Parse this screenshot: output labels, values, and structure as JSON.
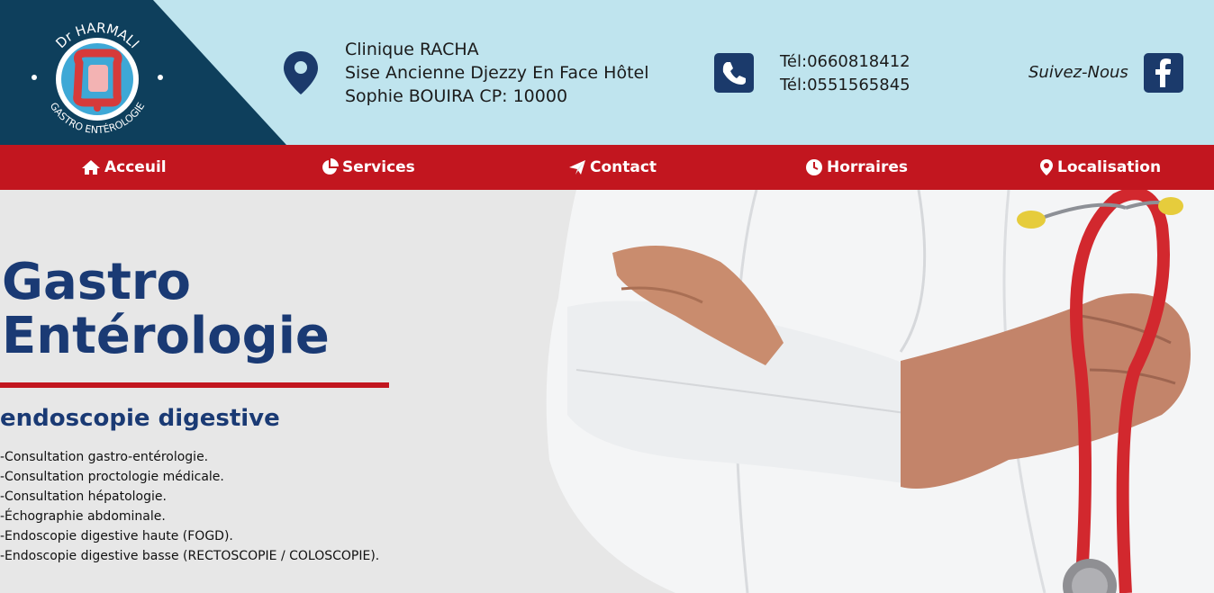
{
  "logo": {
    "top_text": "Dr HARMALI",
    "bottom_text": "GASTRO ENTÉROLOGIE"
  },
  "address": {
    "line1": "Clinique RACHA",
    "line2": "Sise Ancienne Djezzy En Face Hôtel",
    "line3": "Sophie BOUIRA CP: 10000"
  },
  "phones": {
    "tel1": "Tél:0660818412",
    "tel2": "Tél:0551565845"
  },
  "social": {
    "follow_label": "Suivez-Nous"
  },
  "nav": {
    "items": [
      {
        "label": "Acceuil",
        "icon": "home-icon"
      },
      {
        "label": "Services",
        "icon": "pie-chart-icon"
      },
      {
        "label": "Contact",
        "icon": "paper-plane-icon"
      },
      {
        "label": "Horraires",
        "icon": "clock-icon"
      },
      {
        "label": "Localisation",
        "icon": "location-pin-icon"
      }
    ]
  },
  "hero": {
    "title_line1": "Gastro",
    "title_line2": "Entérologie",
    "subtitle": "endoscopie digestive",
    "services": [
      "-Consultation gastro-entérologie.",
      "-Consultation proctologie médicale.",
      "-Consultation hépatologie.",
      "-Échographie abdominale.",
      "-Endoscopie digestive haute (FOGD).",
      "-Endoscopie digestive basse (RECTOSCOPIE / COLOSCOPIE)."
    ]
  },
  "colors": {
    "header_bg": "#bfe4ee",
    "nav_bg": "#c2161f",
    "brand_navy": "#1a3a74",
    "logo_bg": "#0e3f5c"
  }
}
